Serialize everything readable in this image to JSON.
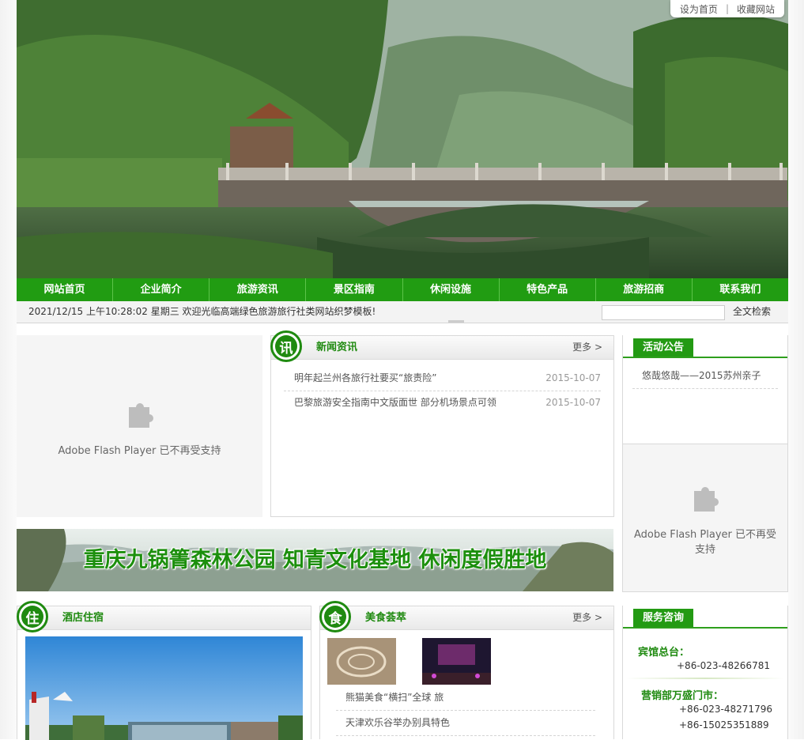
{
  "top_links": {
    "home": "设为首页",
    "separator": "|",
    "bookmark": "收藏网站"
  },
  "nav": {
    "items": [
      {
        "label": "网站首页"
      },
      {
        "label": "企业简介"
      },
      {
        "label": "旅游资讯"
      },
      {
        "label": "景区指南"
      },
      {
        "label": "休闲设施"
      },
      {
        "label": "特色产品"
      },
      {
        "label": "旅游招商"
      },
      {
        "label": "联系我们"
      }
    ]
  },
  "infobar": {
    "datetime": "2021/12/15 上午10:28:02 星期三",
    "welcome": "欢迎光临高端绿色旅游旅行社类网站织梦模板!",
    "search_button": "全文检索"
  },
  "flash": {
    "message": "Adobe Flash Player 已不再受支持"
  },
  "news": {
    "badge": "讯",
    "title": "新闻资讯",
    "more": "更多 >",
    "items": [
      {
        "title": "明年起兰州各旅行社要买“旅责险”",
        "date": "2015-10-07"
      },
      {
        "title": "巴黎旅游安全指南中文版面世 部分机场景点可领",
        "date": "2015-10-07"
      }
    ]
  },
  "notice": {
    "title": "活动公告",
    "items": [
      {
        "title": "悠哉悠哉——2015苏州亲子"
      }
    ]
  },
  "slogan_banner": {
    "text": "重庆九锅箐森林公园 知青文化基地 休闲度假胜地"
  },
  "hotel": {
    "badge": "住",
    "title": "酒店住宿"
  },
  "food": {
    "badge": "食",
    "title": "美食荟萃",
    "more": "更多 >",
    "items": [
      {
        "title": "熊猫美食“横扫”全球 旅"
      },
      {
        "title": "天津欢乐谷举办别具特色"
      }
    ]
  },
  "service": {
    "title": "服务咨询",
    "hotel_desk_label": "宾馆总台：",
    "hotel_desk_phone": "+86-023-48266781",
    "sales_label": "营销部万盛门市：",
    "sales_phone_1": "+86-023-48271796",
    "sales_phone_2": "+86-15025351889"
  },
  "colors": {
    "brand_green": "#219c12",
    "accent_dark_green": "#1f8a10",
    "text_gray": "#555555"
  }
}
